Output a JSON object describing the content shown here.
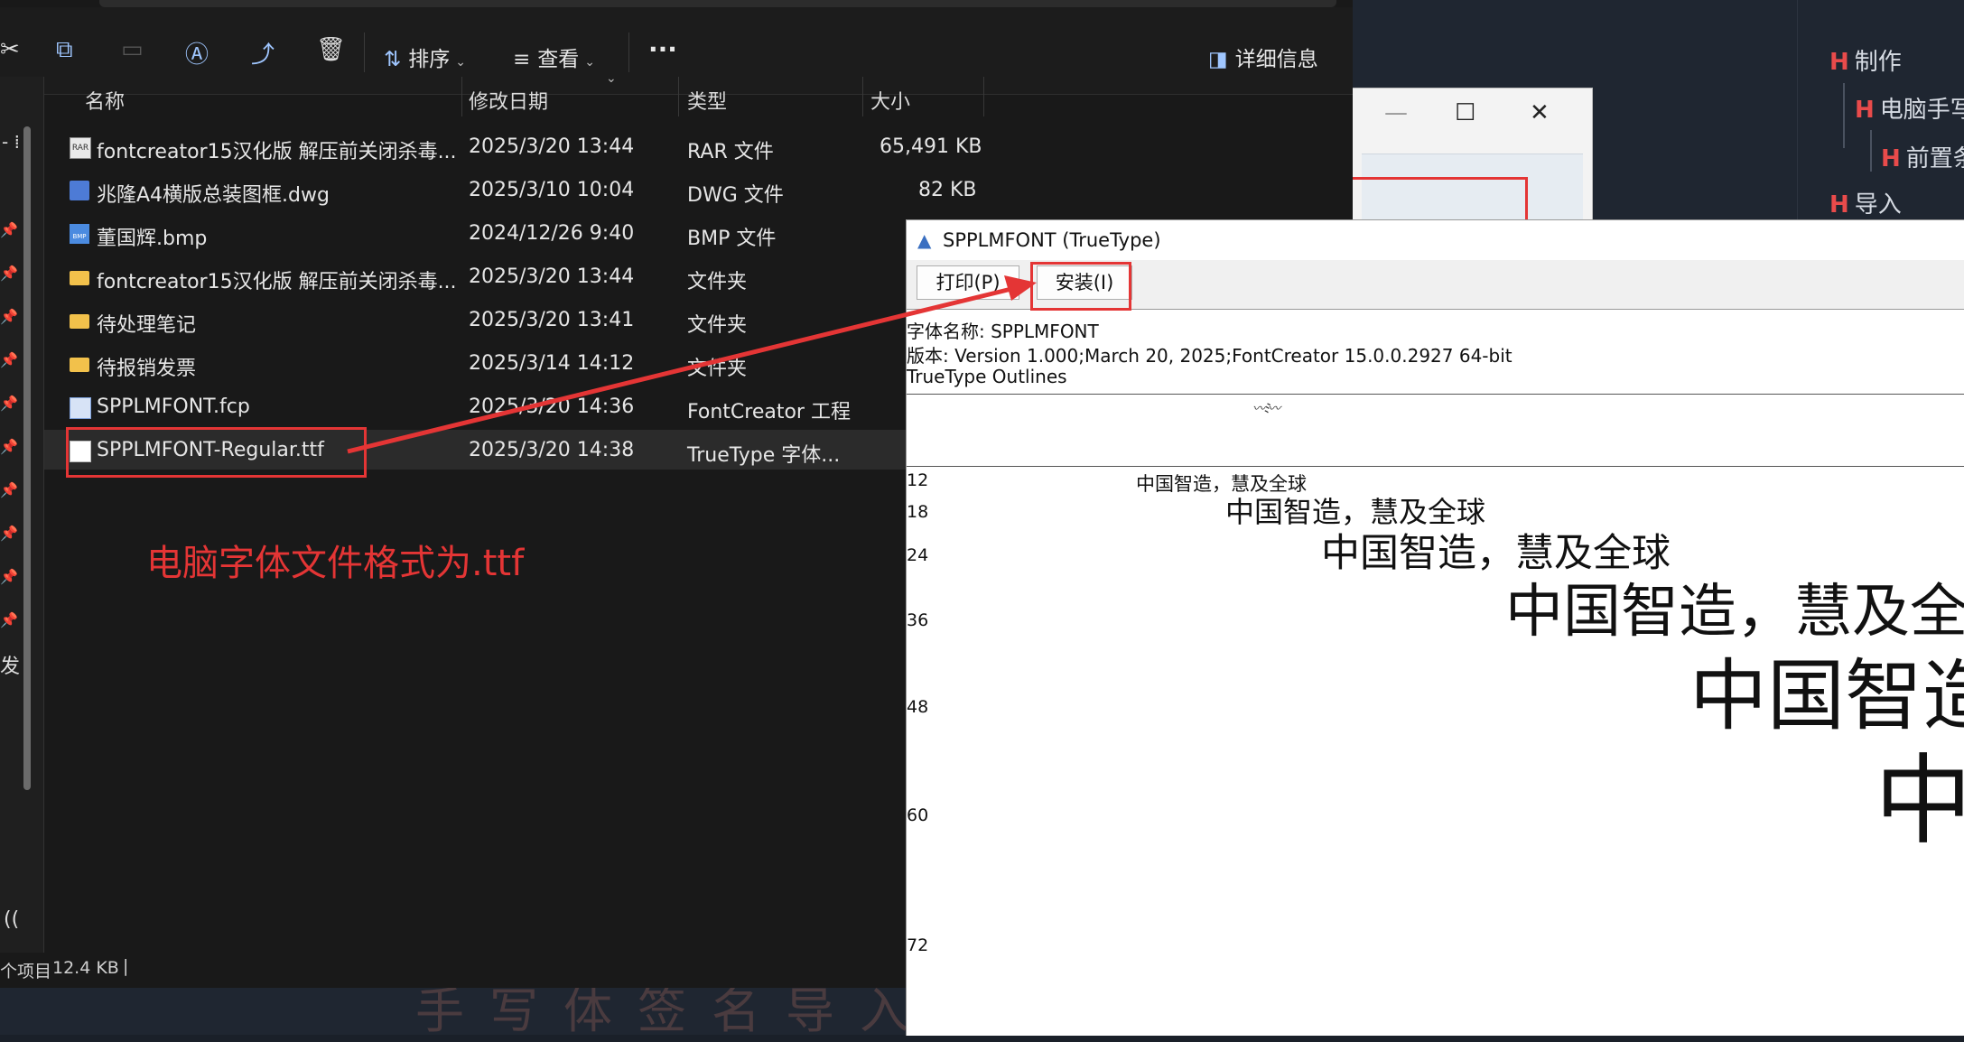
{
  "outline": {
    "items": [
      {
        "marker": "H",
        "label": "制作"
      },
      {
        "marker": "H",
        "label": "电脑手写"
      },
      {
        "marker": "H",
        "label": "前置条"
      },
      {
        "marker": "H",
        "label": "导入"
      }
    ]
  },
  "background_text": "手写体签名导入",
  "small_window": {
    "minimize": "—",
    "maximize": "☐",
    "close": "✕"
  },
  "explorer": {
    "toolbar": {
      "sort_label": "排序",
      "view_label": "查看",
      "more_label": "···",
      "details_label": "详细信息"
    },
    "columns": {
      "name": "名称",
      "modified": "修改日期",
      "type": "类型",
      "size": "大小"
    },
    "files": [
      {
        "icon": "rar-file-icon",
        "name": "fontcreator15汉化版 解压前关闭杀毒...",
        "modified": "2025/3/20 13:44",
        "type": "RAR 文件",
        "size": "65,491 KB"
      },
      {
        "icon": "dwg-file-icon",
        "name": "兆隆A4横版总装图框.dwg",
        "modified": "2025/3/10 10:04",
        "type": "DWG 文件",
        "size": "82 KB"
      },
      {
        "icon": "bmp-file-icon",
        "name": "董国辉.bmp",
        "modified": "2024/12/26 9:40",
        "type": "BMP 文件",
        "size": ""
      },
      {
        "icon": "folder-icon",
        "name": "fontcreator15汉化版 解压前关闭杀毒...",
        "modified": "2025/3/20 13:44",
        "type": "文件夹",
        "size": ""
      },
      {
        "icon": "folder-icon",
        "name": "待处理笔记",
        "modified": "2025/3/20 13:41",
        "type": "文件夹",
        "size": ""
      },
      {
        "icon": "folder-icon",
        "name": "待报销发票",
        "modified": "2025/3/14 14:12",
        "type": "文件夹",
        "size": ""
      },
      {
        "icon": "fcp-file-icon",
        "name": "SPPLMFONT.fcp",
        "modified": "2025/3/20 14:36",
        "type": "FontCreator 工程",
        "size": ""
      },
      {
        "icon": "ttf-file-icon",
        "name": "SPPLMFONT-Regular.ttf",
        "modified": "2025/3/20 14:38",
        "type": "TrueType 字体...",
        "size": ""
      }
    ],
    "nav": {
      "fa_text": "发",
      "paren_text": "(("
    },
    "status": {
      "items": "个项目",
      "size": "12.4 KB"
    }
  },
  "annotation": {
    "text": "电脑字体文件格式为.ttf",
    "color": "#e43535"
  },
  "font_window": {
    "title": "SPPLMFONT (TrueType)",
    "print_button": "打印(P)",
    "install_button": "安装(I)",
    "font_name_line": "字体名称: SPPLMFONT",
    "version_line": "版本: Version 1.000;March 20, 2025;FontCreator 15.0.0.2927 64-bit",
    "outline_line": "TrueType Outlines",
    "samples": [
      {
        "size": "12",
        "text": "中国智造，慧及全球"
      },
      {
        "size": "18",
        "text": "中国智造，慧及全球"
      },
      {
        "size": "24",
        "text": "中国智造，慧及全球"
      },
      {
        "size": "36",
        "text": "中国智造，慧及全"
      },
      {
        "size": "48",
        "text": "中国智造"
      },
      {
        "size": "60",
        "text": "中"
      },
      {
        "size": "72",
        "text": ""
      }
    ]
  }
}
